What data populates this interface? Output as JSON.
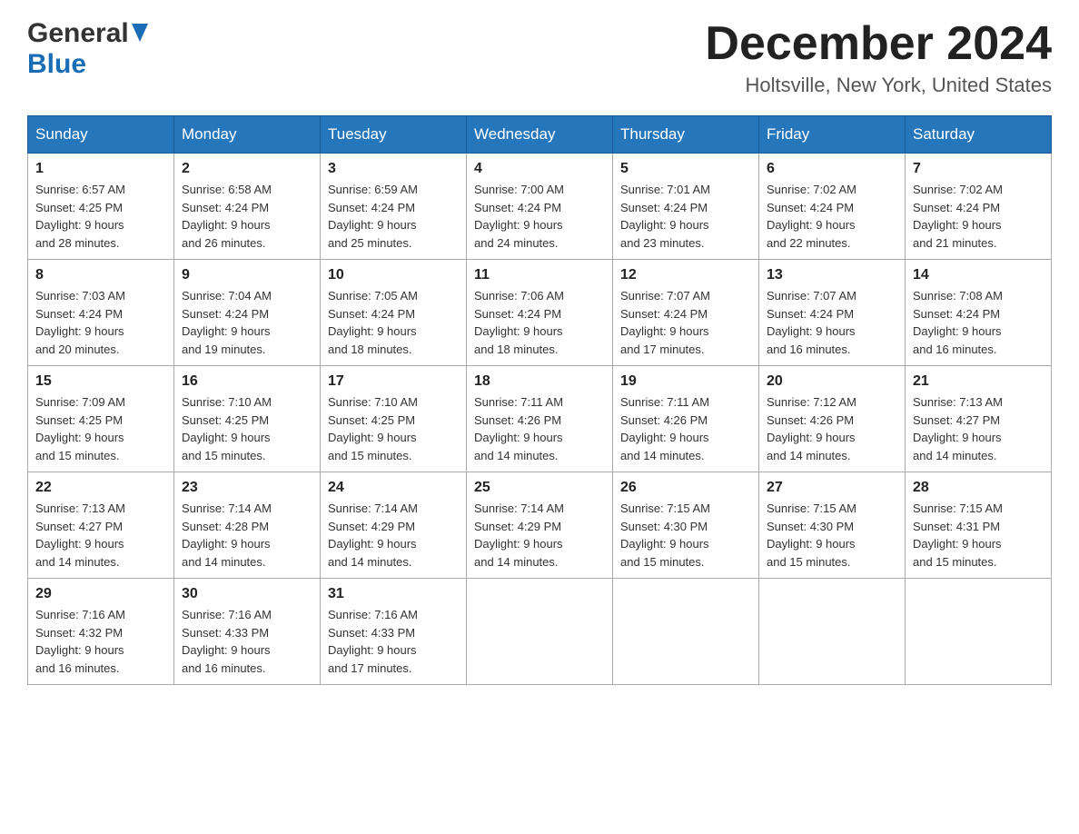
{
  "logo": {
    "general": "General",
    "blue": "Blue"
  },
  "title": "December 2024",
  "location": "Holtsville, New York, United States",
  "days_of_week": [
    "Sunday",
    "Monday",
    "Tuesday",
    "Wednesday",
    "Thursday",
    "Friday",
    "Saturday"
  ],
  "weeks": [
    [
      {
        "day": "1",
        "sunrise": "6:57 AM",
        "sunset": "4:25 PM",
        "daylight": "9 hours and 28 minutes."
      },
      {
        "day": "2",
        "sunrise": "6:58 AM",
        "sunset": "4:24 PM",
        "daylight": "9 hours and 26 minutes."
      },
      {
        "day": "3",
        "sunrise": "6:59 AM",
        "sunset": "4:24 PM",
        "daylight": "9 hours and 25 minutes."
      },
      {
        "day": "4",
        "sunrise": "7:00 AM",
        "sunset": "4:24 PM",
        "daylight": "9 hours and 24 minutes."
      },
      {
        "day": "5",
        "sunrise": "7:01 AM",
        "sunset": "4:24 PM",
        "daylight": "9 hours and 23 minutes."
      },
      {
        "day": "6",
        "sunrise": "7:02 AM",
        "sunset": "4:24 PM",
        "daylight": "9 hours and 22 minutes."
      },
      {
        "day": "7",
        "sunrise": "7:02 AM",
        "sunset": "4:24 PM",
        "daylight": "9 hours and 21 minutes."
      }
    ],
    [
      {
        "day": "8",
        "sunrise": "7:03 AM",
        "sunset": "4:24 PM",
        "daylight": "9 hours and 20 minutes."
      },
      {
        "day": "9",
        "sunrise": "7:04 AM",
        "sunset": "4:24 PM",
        "daylight": "9 hours and 19 minutes."
      },
      {
        "day": "10",
        "sunrise": "7:05 AM",
        "sunset": "4:24 PM",
        "daylight": "9 hours and 18 minutes."
      },
      {
        "day": "11",
        "sunrise": "7:06 AM",
        "sunset": "4:24 PM",
        "daylight": "9 hours and 18 minutes."
      },
      {
        "day": "12",
        "sunrise": "7:07 AM",
        "sunset": "4:24 PM",
        "daylight": "9 hours and 17 minutes."
      },
      {
        "day": "13",
        "sunrise": "7:07 AM",
        "sunset": "4:24 PM",
        "daylight": "9 hours and 16 minutes."
      },
      {
        "day": "14",
        "sunrise": "7:08 AM",
        "sunset": "4:24 PM",
        "daylight": "9 hours and 16 minutes."
      }
    ],
    [
      {
        "day": "15",
        "sunrise": "7:09 AM",
        "sunset": "4:25 PM",
        "daylight": "9 hours and 15 minutes."
      },
      {
        "day": "16",
        "sunrise": "7:10 AM",
        "sunset": "4:25 PM",
        "daylight": "9 hours and 15 minutes."
      },
      {
        "day": "17",
        "sunrise": "7:10 AM",
        "sunset": "4:25 PM",
        "daylight": "9 hours and 15 minutes."
      },
      {
        "day": "18",
        "sunrise": "7:11 AM",
        "sunset": "4:26 PM",
        "daylight": "9 hours and 14 minutes."
      },
      {
        "day": "19",
        "sunrise": "7:11 AM",
        "sunset": "4:26 PM",
        "daylight": "9 hours and 14 minutes."
      },
      {
        "day": "20",
        "sunrise": "7:12 AM",
        "sunset": "4:26 PM",
        "daylight": "9 hours and 14 minutes."
      },
      {
        "day": "21",
        "sunrise": "7:13 AM",
        "sunset": "4:27 PM",
        "daylight": "9 hours and 14 minutes."
      }
    ],
    [
      {
        "day": "22",
        "sunrise": "7:13 AM",
        "sunset": "4:27 PM",
        "daylight": "9 hours and 14 minutes."
      },
      {
        "day": "23",
        "sunrise": "7:14 AM",
        "sunset": "4:28 PM",
        "daylight": "9 hours and 14 minutes."
      },
      {
        "day": "24",
        "sunrise": "7:14 AM",
        "sunset": "4:29 PM",
        "daylight": "9 hours and 14 minutes."
      },
      {
        "day": "25",
        "sunrise": "7:14 AM",
        "sunset": "4:29 PM",
        "daylight": "9 hours and 14 minutes."
      },
      {
        "day": "26",
        "sunrise": "7:15 AM",
        "sunset": "4:30 PM",
        "daylight": "9 hours and 15 minutes."
      },
      {
        "day": "27",
        "sunrise": "7:15 AM",
        "sunset": "4:30 PM",
        "daylight": "9 hours and 15 minutes."
      },
      {
        "day": "28",
        "sunrise": "7:15 AM",
        "sunset": "4:31 PM",
        "daylight": "9 hours and 15 minutes."
      }
    ],
    [
      {
        "day": "29",
        "sunrise": "7:16 AM",
        "sunset": "4:32 PM",
        "daylight": "9 hours and 16 minutes."
      },
      {
        "day": "30",
        "sunrise": "7:16 AM",
        "sunset": "4:33 PM",
        "daylight": "9 hours and 16 minutes."
      },
      {
        "day": "31",
        "sunrise": "7:16 AM",
        "sunset": "4:33 PM",
        "daylight": "9 hours and 17 minutes."
      },
      null,
      null,
      null,
      null
    ]
  ],
  "labels": {
    "sunrise": "Sunrise:",
    "sunset": "Sunset:",
    "daylight": "Daylight:"
  }
}
